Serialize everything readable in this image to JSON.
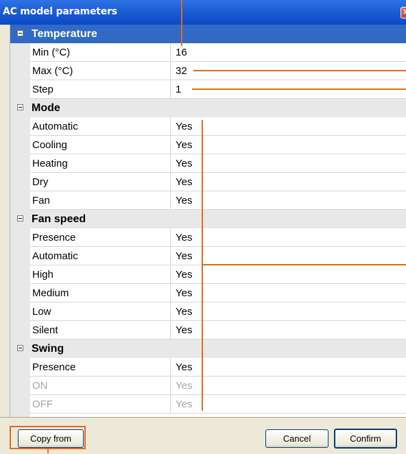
{
  "window": {
    "title": "AC model parameters",
    "close_glyph": "✕"
  },
  "categories": {
    "temperature": {
      "label": "Temperature",
      "props": [
        {
          "name": "Min (°C)",
          "value": "16"
        },
        {
          "name": "Max (°C)",
          "value": "32"
        },
        {
          "name": "Step",
          "value": "1"
        }
      ]
    },
    "mode": {
      "label": "Mode",
      "props": [
        {
          "name": "Automatic",
          "value": "Yes"
        },
        {
          "name": "Cooling",
          "value": "Yes"
        },
        {
          "name": "Heating",
          "value": "Yes"
        },
        {
          "name": "Dry",
          "value": "Yes"
        },
        {
          "name": "Fan",
          "value": "Yes"
        }
      ]
    },
    "fan_speed": {
      "label": "Fan speed",
      "props": [
        {
          "name": "Presence",
          "value": "Yes"
        },
        {
          "name": "Automatic",
          "value": "Yes"
        },
        {
          "name": "High",
          "value": "Yes"
        },
        {
          "name": "Medium",
          "value": "Yes"
        },
        {
          "name": "Low",
          "value": "Yes"
        },
        {
          "name": "Silent",
          "value": "Yes"
        }
      ]
    },
    "swing": {
      "label": "Swing",
      "props": [
        {
          "name": "Presence",
          "value": "Yes"
        },
        {
          "name": "ON",
          "value": "Yes"
        },
        {
          "name": "OFF",
          "value": "Yes"
        }
      ]
    }
  },
  "buttons": {
    "copy_from": "Copy from",
    "cancel": "Cancel",
    "confirm": "Confirm"
  },
  "colors": {
    "title_bar": "#0b48c4",
    "selected_category": "#316ac5",
    "annotation": "#e06a1f",
    "disabled_text": "#a4a4a4"
  },
  "icons": {
    "expander": "collapse-icon",
    "close": "close-icon"
  }
}
